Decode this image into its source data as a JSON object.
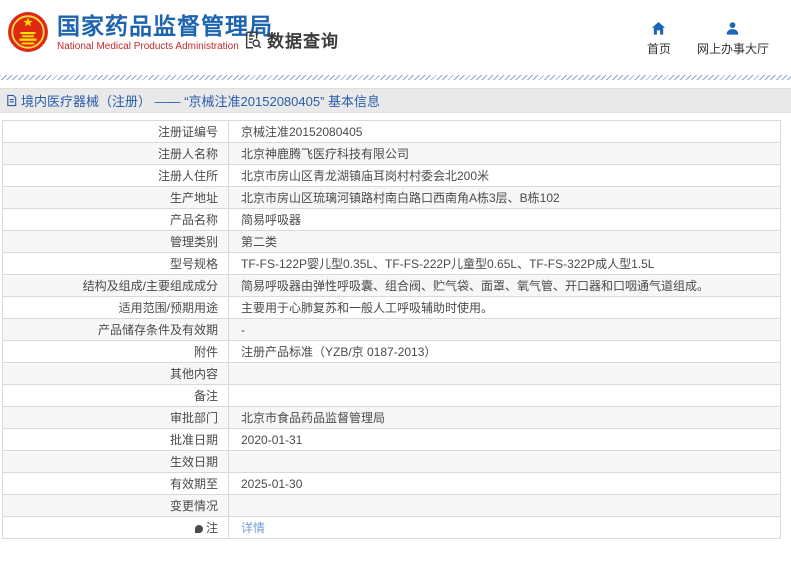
{
  "header": {
    "agency_title": "国家药品监督管理局",
    "agency_subtitle": "National Medical Products Administration",
    "section_label": "数据查询",
    "nav_items": [
      {
        "label": "首页",
        "icon": "home-icon"
      },
      {
        "label": "网上办事大厅",
        "icon": "person-icon"
      }
    ]
  },
  "breadcrumb": {
    "text": "境内医疗器械（注册） —— “京械注准20152080405” 基本信息"
  },
  "table": {
    "rows": [
      {
        "label": "注册证编号",
        "value": "京械注准20152080405"
      },
      {
        "label": "注册人名称",
        "value": "北京神鹿腾飞医疗科技有限公司"
      },
      {
        "label": "注册人住所",
        "value": "北京市房山区青龙湖镇庙耳岗村村委会北200米"
      },
      {
        "label": "生产地址",
        "value": "北京市房山区琉璃河镇路村南白路口西南角A栋3层、B栋102"
      },
      {
        "label": "产品名称",
        "value": "简易呼吸器"
      },
      {
        "label": "管理类别",
        "value": "第二类"
      },
      {
        "label": "型号规格",
        "value": "TF-FS-122P婴儿型0.35L、TF-FS-222P儿童型0.65L、TF-FS-322P成人型1.5L"
      },
      {
        "label": "结构及组成/主要组成成分",
        "value": "简易呼吸器由弹性呼吸囊、组合阀、贮气袋、面罩、氧气管、开口器和口咽通气道组成。"
      },
      {
        "label": "适用范围/预期用途",
        "value": "主要用于心肺复苏和一般人工呼吸辅助时使用。"
      },
      {
        "label": "产品储存条件及有效期",
        "value": "-"
      },
      {
        "label": "附件",
        "value": "注册产品标准（YZB/京 0187-2013）"
      },
      {
        "label": "其他内容",
        "value": ""
      },
      {
        "label": "备注",
        "value": ""
      },
      {
        "label": "审批部门",
        "value": "北京市食品药品监督管理局"
      },
      {
        "label": "批准日期",
        "value": "2020-01-31"
      },
      {
        "label": "生效日期",
        "value": ""
      },
      {
        "label": "有效期至",
        "value": "2025-01-30"
      },
      {
        "label": "变更情况",
        "value": ""
      },
      {
        "label": "注",
        "value": "详情",
        "is_link": true,
        "has_icon": true
      }
    ]
  },
  "colors": {
    "title_blue": "#1e63b0",
    "subtitle_red": "#c1272d",
    "nav_icon_blue": "#1a66b8",
    "breadcrumb_blue": "#2a5caa",
    "link_blue": "#6f9ed9",
    "emblem_red": "#de2910",
    "emblem_yellow": "#ffde00"
  }
}
